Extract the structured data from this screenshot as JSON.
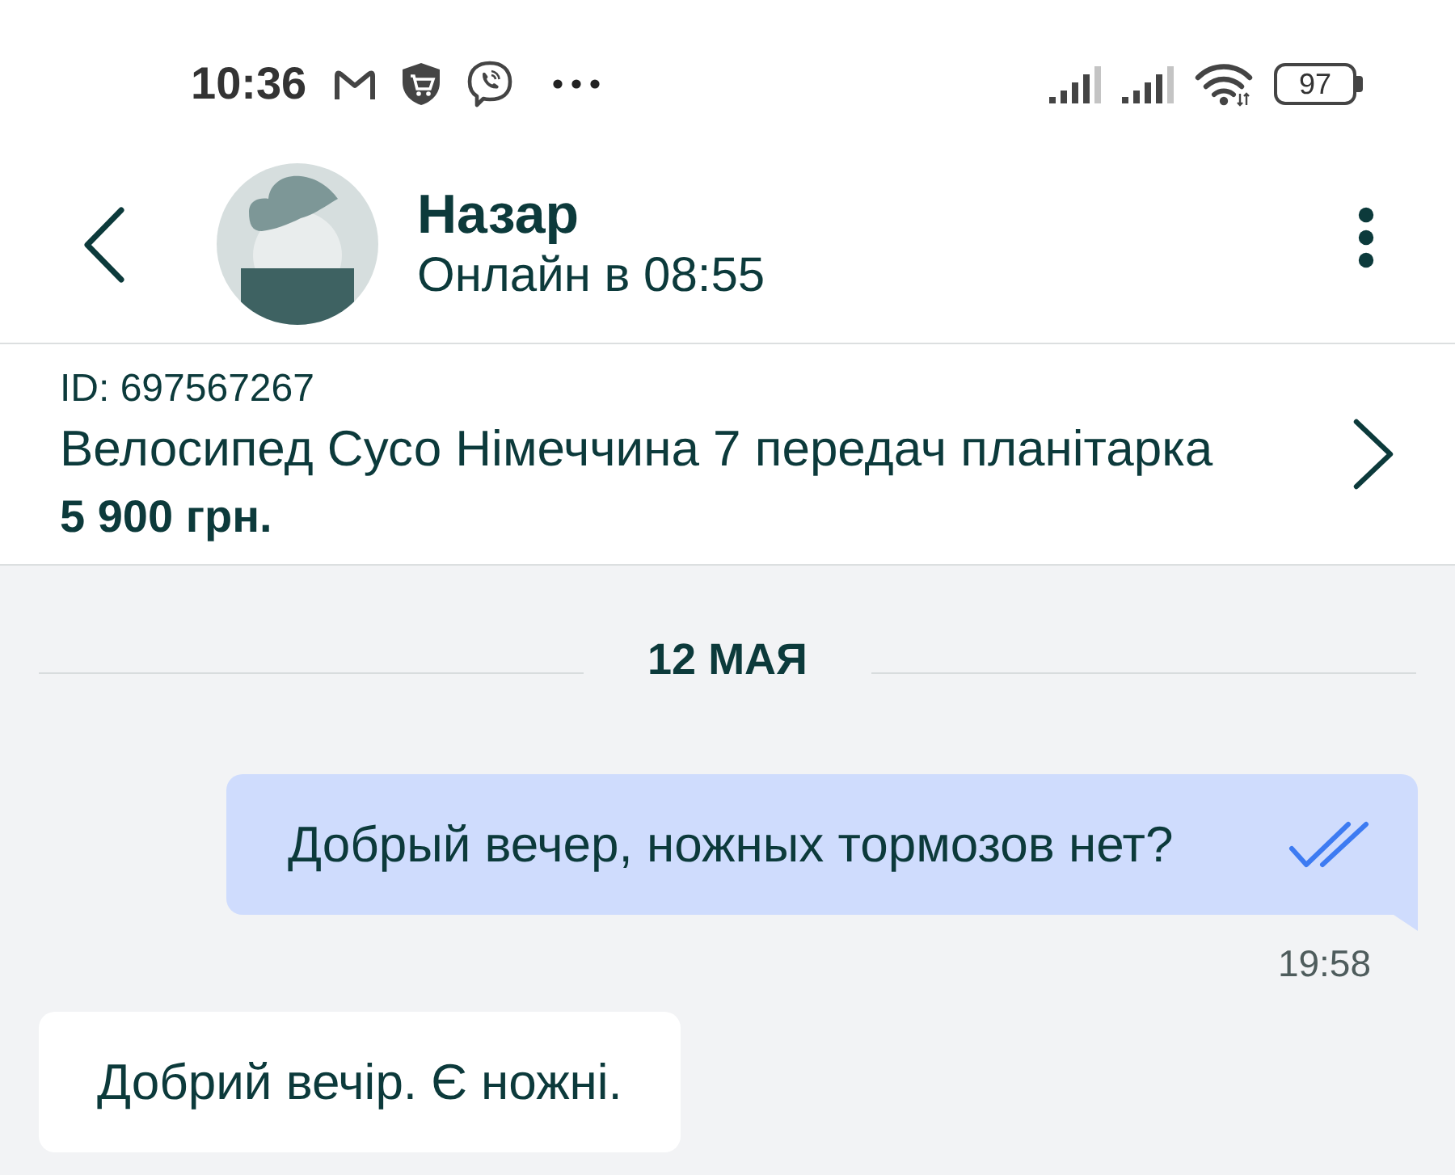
{
  "status_bar": {
    "time": "10:36",
    "battery": "97"
  },
  "chat_header": {
    "name": "Назар",
    "status": "Онлайн в 08:55"
  },
  "listing": {
    "id": "ID: 697567267",
    "title": "Велосипед Сусо Німеччина 7 передач планітарка",
    "price": "5 900 грн."
  },
  "date_separator": "12 МАЯ",
  "messages": [
    {
      "kind": "outgoing",
      "text": "Добрый вечер, ножных тормозов нет?",
      "read": true,
      "time": "19:58"
    },
    {
      "kind": "incoming",
      "text": "Добрий вечір. Є ножні."
    }
  ]
}
